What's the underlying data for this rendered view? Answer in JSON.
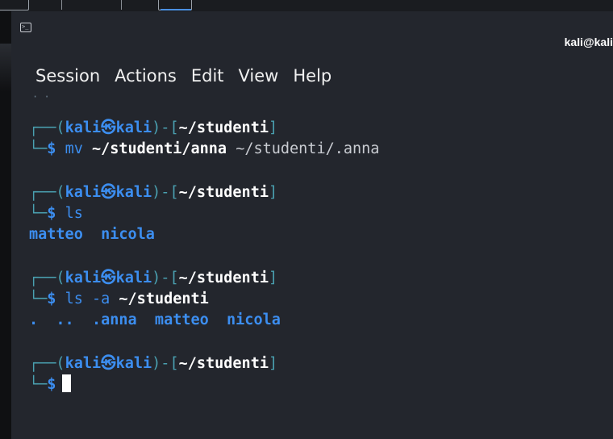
{
  "window": {
    "title": "kali@kali"
  },
  "menu": [
    "Session",
    "Actions",
    "Edit",
    "View",
    "Help"
  ],
  "terminal": {
    "prompt": {
      "user_host": "kali㉿kali",
      "path": "~/studenti"
    },
    "blocks": [
      {
        "command": "mv",
        "arg_bold": "~/studenti/anna",
        "arg_normal": " ~/studenti/.anna",
        "output": ""
      },
      {
        "command": "ls",
        "arg_bold": "",
        "arg_normal": "",
        "output": "matteo  nicola"
      },
      {
        "command": "ls -a",
        "arg_bold": "~/studenti",
        "arg_normal": "",
        "output": ".  ..  .anna  matteo  nicola"
      },
      {
        "command": "",
        "arg_bold": "",
        "arg_normal": "",
        "output": ""
      }
    ]
  },
  "icons": {
    "terminal_icon": "terminal-icon"
  }
}
